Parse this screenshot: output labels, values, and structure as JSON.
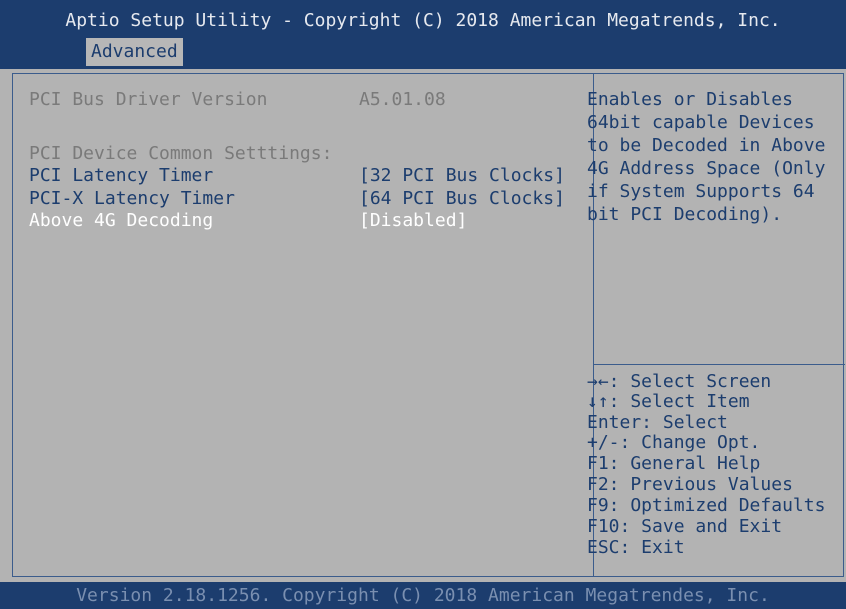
{
  "header": {
    "title": "Aptio Setup Utility - Copyright (C) 2018 American Megatrends, Inc.",
    "active_tab": "Advanced"
  },
  "main": {
    "driver_version_label": "PCI Bus Driver Version",
    "driver_version_value": "A5.01.08",
    "section_heading": "PCI Device Common Setttings:",
    "settings": [
      {
        "label": "PCI Latency Timer",
        "value": "[32 PCI Bus Clocks]"
      },
      {
        "label": "PCI-X Latency Timer",
        "value": "[64 PCI Bus Clocks]"
      },
      {
        "label": "Above 4G Decoding",
        "value": "[Disabled]"
      }
    ]
  },
  "help": {
    "description_lines": [
      "Enables or Disables",
      "64bit capable Devices",
      "to be Decoded in Above",
      "4G Address Space (Only",
      "if System Supports 64",
      "bit PCI Decoding)."
    ],
    "keys": [
      "→←: Select Screen",
      "↓↑: Select Item",
      "Enter: Select",
      "+/-: Change Opt.",
      "F1: General Help",
      "F2: Previous Values",
      "F9: Optimized Defaults",
      "F10: Save and Exit",
      "ESC: Exit"
    ]
  },
  "footer": {
    "text": "Version 2.18.1256. Copyright (C) 2018 American Megatrendes, Inc."
  },
  "colors": {
    "header_bg": "#1c3d6e",
    "panel_bg": "#b3b3b3",
    "selectable_text": "#1c3d6e",
    "highlight_text": "#ffffff",
    "static_text": "#7a7a7a"
  }
}
